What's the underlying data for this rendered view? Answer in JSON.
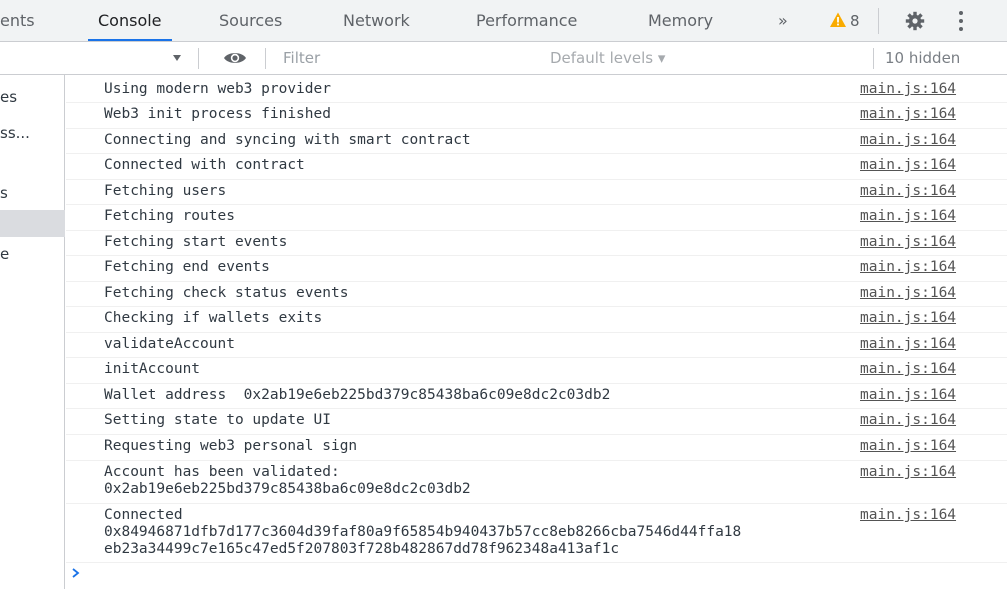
{
  "tabs": [
    {
      "label": "ents",
      "active": false
    },
    {
      "label": "Console",
      "active": true
    },
    {
      "label": "Sources",
      "active": false
    },
    {
      "label": "Network",
      "active": false
    },
    {
      "label": "Performance",
      "active": false
    },
    {
      "label": "Memory",
      "active": false
    }
  ],
  "tab_overflow": "»",
  "warnings": {
    "count": "8",
    "icon": "warning-triangle-icon",
    "color": "#f9ab00"
  },
  "toolbar": {
    "filter_placeholder": "Filter",
    "levels_label": "Default levels ▾",
    "hidden_label": "10 hidden"
  },
  "sidebar": {
    "items": [
      "es",
      "ss...",
      "s",
      "e"
    ]
  },
  "messages": [
    {
      "text": "Using modern web3 provider",
      "source": "main.js:164"
    },
    {
      "text": "Web3 init process finished",
      "source": "main.js:164"
    },
    {
      "text": "Connecting and syncing with smart contract",
      "source": "main.js:164"
    },
    {
      "text": "Connected with contract",
      "source": "main.js:164"
    },
    {
      "text": "Fetching users",
      "source": "main.js:164"
    },
    {
      "text": "Fetching routes",
      "source": "main.js:164"
    },
    {
      "text": "Fetching start events",
      "source": "main.js:164"
    },
    {
      "text": "Fetching end events",
      "source": "main.js:164"
    },
    {
      "text": "Fetching check status events",
      "source": "main.js:164"
    },
    {
      "text": "Checking if wallets exits",
      "source": "main.js:164"
    },
    {
      "text": "validateAccount",
      "source": "main.js:164"
    },
    {
      "text": "initAccount",
      "source": "main.js:164"
    },
    {
      "text": "Wallet address  0x2ab19e6eb225bd379c85438ba6c09e8dc2c03db2",
      "source": "main.js:164"
    },
    {
      "text": "Setting state to update UI",
      "source": "main.js:164"
    },
    {
      "text": "Requesting web3 personal sign",
      "source": "main.js:164"
    },
    {
      "text": "Account has been validated:\n0x2ab19e6eb225bd379c85438ba6c09e8dc2c03db2",
      "source": "main.js:164"
    },
    {
      "text": "Connected\n0x84946871dfb7d177c3604d39faf80a9f65854b940437b57cc8eb8266cba7546d44ffa18\neb23a34499c7e165c47ed5f207803f728b482867dd78f962348a413af1c",
      "source": "main.js:164"
    }
  ],
  "colors": {
    "accent": "#1a73e8",
    "warning": "#f9ab00",
    "prompt": "#1a73e8"
  }
}
